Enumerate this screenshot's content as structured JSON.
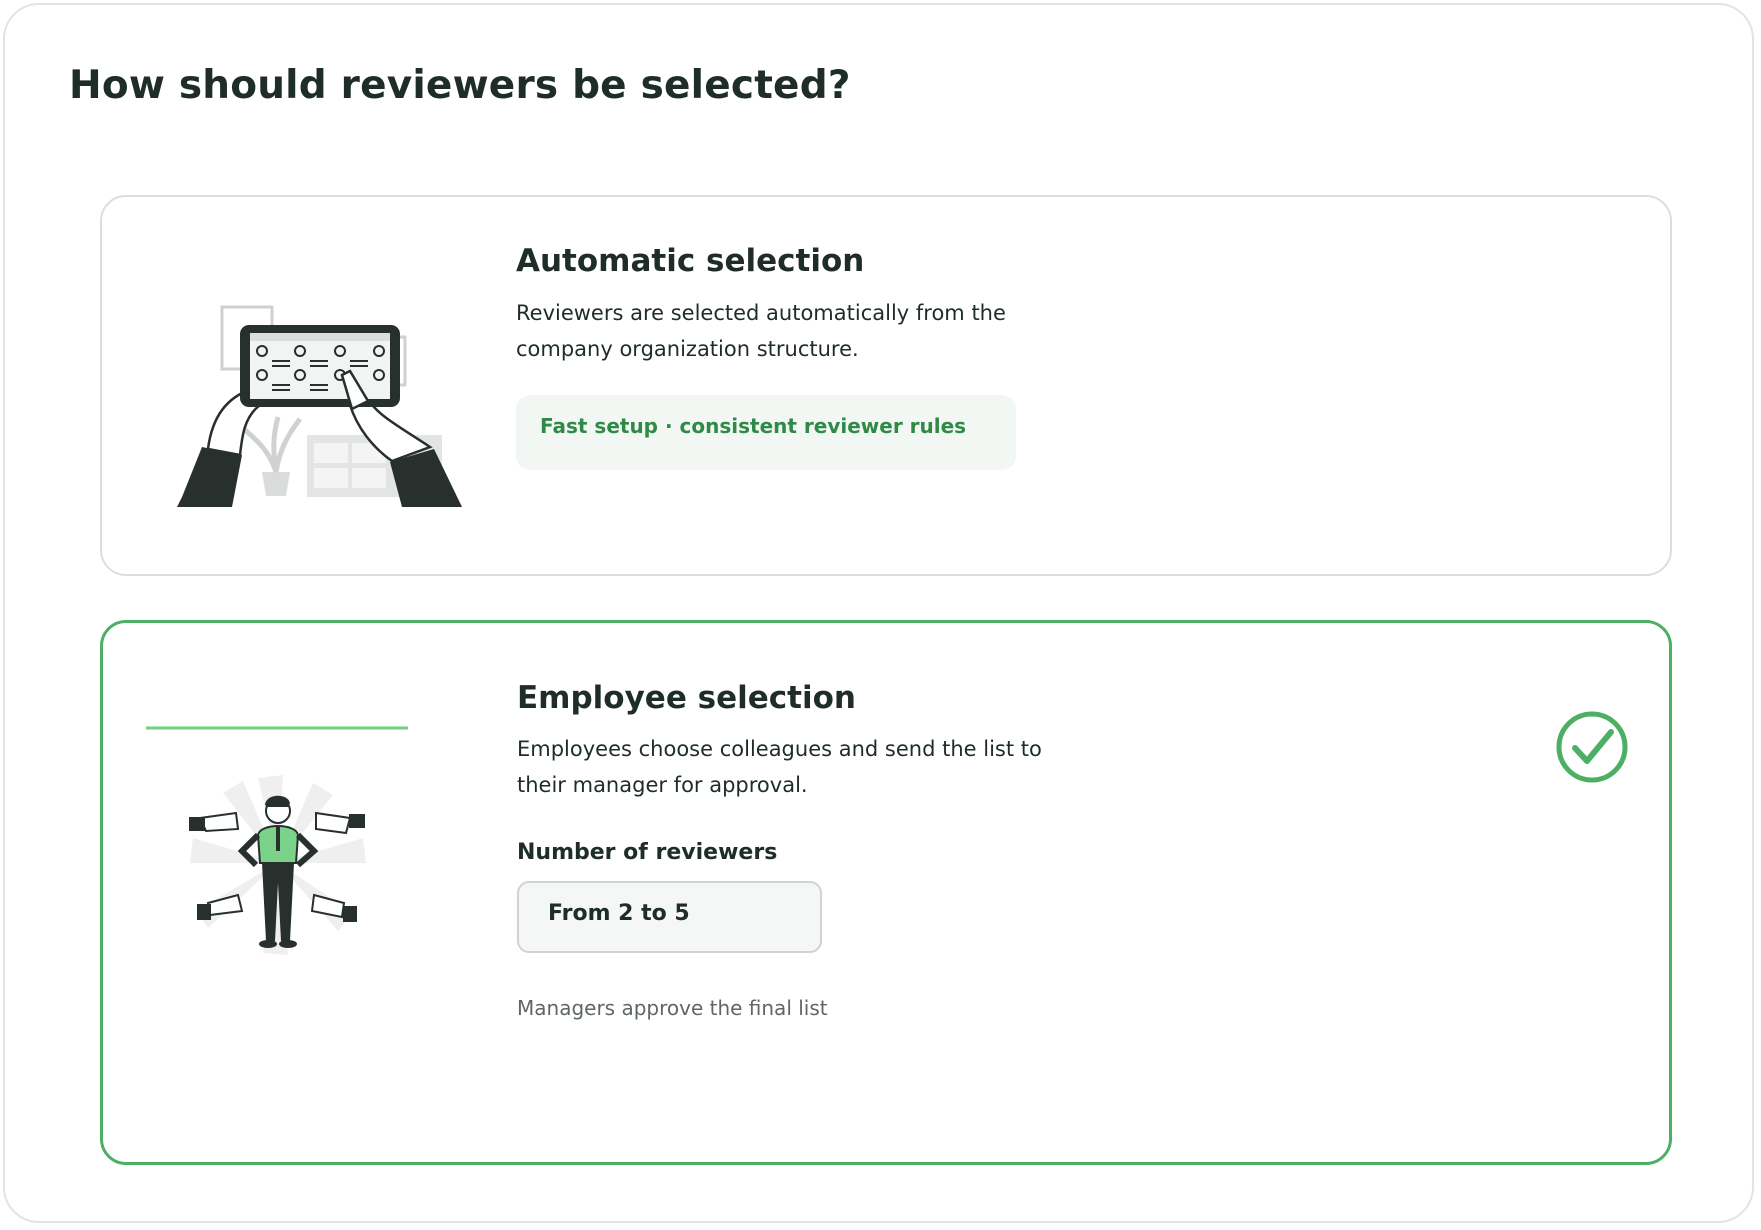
{
  "page": {
    "title": "How should reviewers be selected?"
  },
  "options": {
    "automatic": {
      "title": "Automatic selection",
      "description": "Reviewers are selected automatically from the company organization structure.",
      "tag": "Fast setup · consistent reviewer rules",
      "illustration": "tablet-org-chart-illustration"
    },
    "employee": {
      "title": "Employee selection",
      "description": "Employees choose colleagues and send the list to their manager for approval.",
      "reviewers_label": "Number of reviewers",
      "reviewers_value": "From 2 to 5",
      "hint": "Managers approve the final list",
      "selected": true,
      "illustration": "man-with-thumbs-up-illustration",
      "check_icon": "check-circle-icon"
    }
  },
  "colors": {
    "accent": "#4caf63",
    "accent_text": "#2f8a47",
    "border": "#dcdedd",
    "text": "#1f2d27",
    "muted": "#5f6763"
  }
}
